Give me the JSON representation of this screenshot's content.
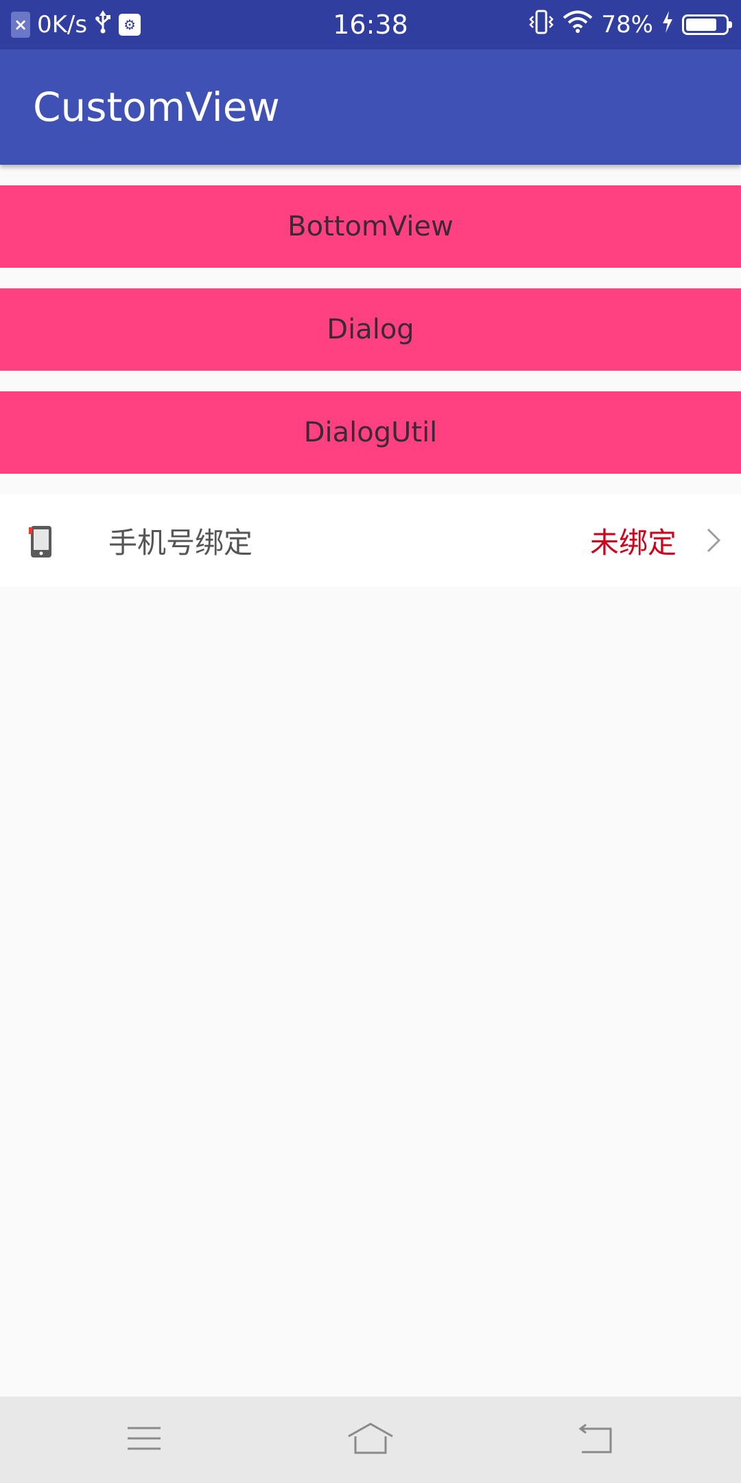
{
  "status_bar": {
    "net_speed": "0K/s",
    "time": "16:38",
    "battery_percent": "78%",
    "battery_level": 0.78
  },
  "app_bar": {
    "title": "CustomView"
  },
  "buttons": [
    {
      "label": "BottomView"
    },
    {
      "label": "Dialog"
    },
    {
      "label": "DialogUtil"
    }
  ],
  "phone_binding": {
    "label": "手机号绑定",
    "status": "未绑定",
    "status_color": "#d0021b"
  },
  "colors": {
    "status_bar": "#303f9f",
    "app_bar": "#3f51b5",
    "accent": "#ff4081"
  },
  "icons": {
    "sim": "sim-absent-icon",
    "usb": "usb-icon",
    "debug": "usb-debug-icon",
    "vibrate": "vibrate-icon",
    "wifi": "wifi-icon",
    "charging": "charging-icon",
    "battery": "battery-icon",
    "phone": "phone-icon",
    "chevron": "chevron-right-icon",
    "nav_menu": "menu-icon",
    "nav_home": "home-icon",
    "nav_back": "back-icon"
  }
}
